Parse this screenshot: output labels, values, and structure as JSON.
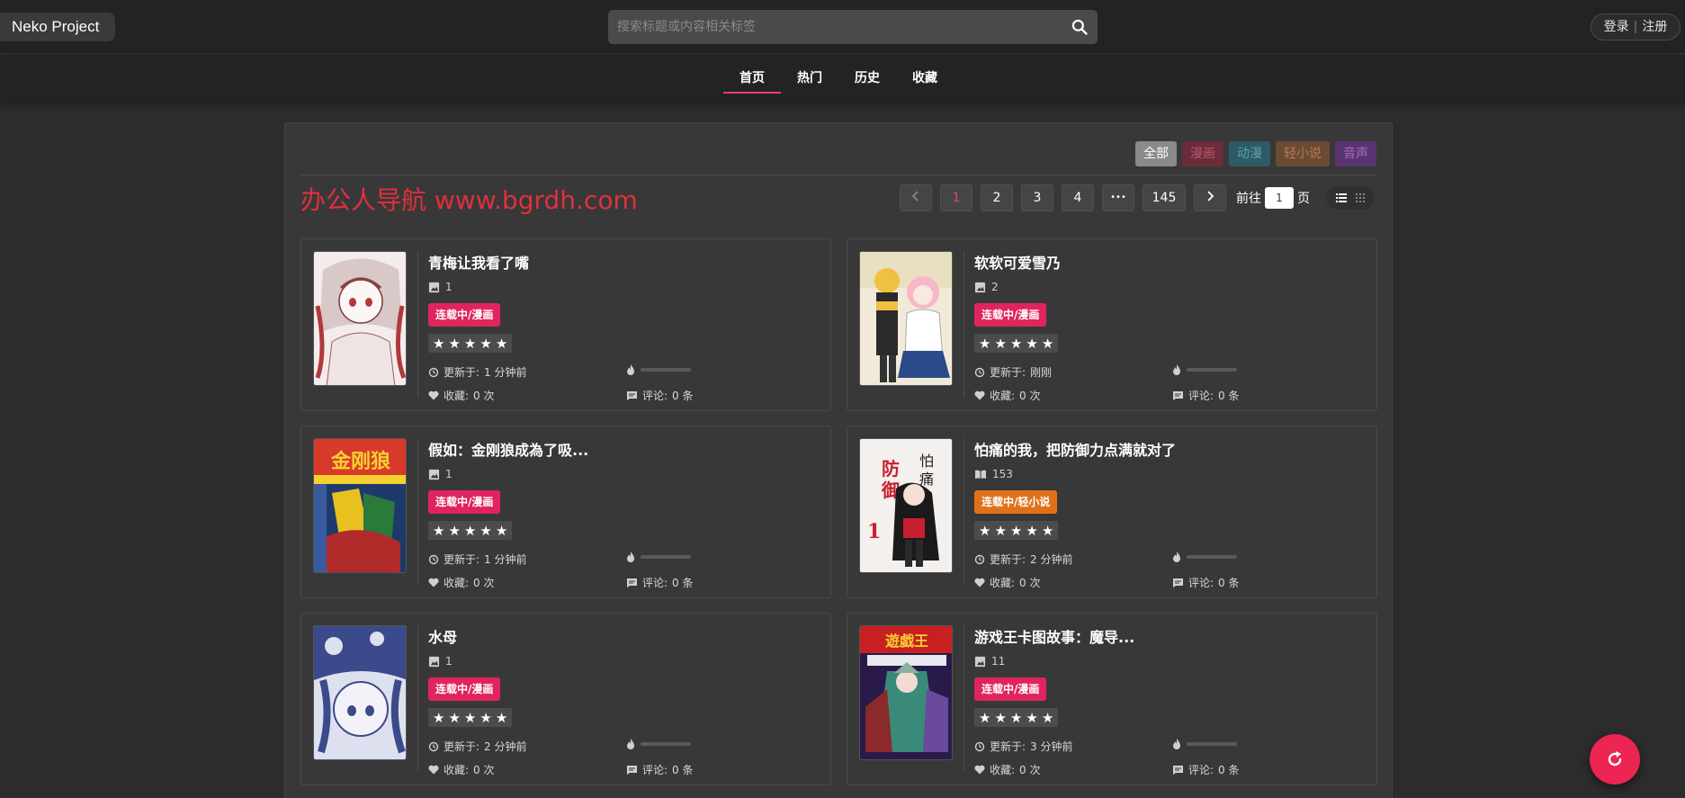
{
  "header": {
    "logo": "Neko Project",
    "search_placeholder": "搜索标题或内容相关标签",
    "login": "登录",
    "register": "注册"
  },
  "nav": [
    {
      "label": "首页",
      "active": true
    },
    {
      "label": "热门",
      "active": false
    },
    {
      "label": "历史",
      "active": false
    },
    {
      "label": "收藏",
      "active": false
    }
  ],
  "filters": [
    {
      "label": "全部",
      "bg": "#8a8a8a",
      "color": "#ffffff"
    },
    {
      "label": "漫画",
      "bg": "#6b2c3b",
      "color": "#b8566d"
    },
    {
      "label": "动漫",
      "bg": "#2d5a66",
      "color": "#5da2b3"
    },
    {
      "label": "轻小说",
      "bg": "#6b4a35",
      "color": "#b57b52"
    },
    {
      "label": "音声",
      "bg": "#5a3470",
      "color": "#a26cc3"
    }
  ],
  "watermark": "办公人导航  www.bgrdh.com",
  "pagination": {
    "prev_icon": "chevron-left-icon",
    "pages": [
      "1",
      "2",
      "3",
      "4"
    ],
    "current": "1",
    "ellipsis": "•••",
    "last": "145",
    "next_icon": "chevron-right-icon",
    "goto_label": "前往",
    "goto_value": "1",
    "goto_suffix": "页"
  },
  "labels": {
    "updated": "更新于:",
    "favorites": "收藏:",
    "comments": "评论:"
  },
  "items": [
    {
      "title": "青梅让我看了嘴",
      "count": "1",
      "count_icon": "image-icon",
      "status": "连载中/漫画",
      "status_color": "#e0245e",
      "rating": 5,
      "updated": "1 分钟前",
      "favorites": "0 次",
      "comments": "0 条",
      "heat": 0
    },
    {
      "title": "软软可爱雪乃",
      "count": "2",
      "count_icon": "image-icon",
      "status": "连载中/漫画",
      "status_color": "#e0245e",
      "rating": 5,
      "updated": "刚刚",
      "favorites": "0 次",
      "comments": "0 条",
      "heat": 0
    },
    {
      "title": "假如：金刚狼成為了吸...",
      "count": "1",
      "count_icon": "image-icon",
      "status": "连载中/漫画",
      "status_color": "#e0245e",
      "rating": 5,
      "updated": "1 分钟前",
      "favorites": "0 次",
      "comments": "0 条",
      "heat": 0
    },
    {
      "title": "怕痛的我，把防御力点满就对了",
      "count": "153",
      "count_icon": "book-icon",
      "status": "连载中/轻小说",
      "status_color": "#e0711a",
      "rating": 5,
      "updated": "2 分钟前",
      "favorites": "0 次",
      "comments": "0 条",
      "heat": 0
    },
    {
      "title": "水母",
      "count": "1",
      "count_icon": "image-icon",
      "status": "连载中/漫画",
      "status_color": "#e0245e",
      "rating": 5,
      "updated": "2 分钟前",
      "favorites": "0 次",
      "comments": "0 条",
      "heat": 0
    },
    {
      "title": "游戏王卡图故事：魔导...",
      "count": "11",
      "count_icon": "image-icon",
      "status": "连载中/漫画",
      "status_color": "#e0245e",
      "rating": 5,
      "updated": "3 分钟前",
      "favorites": "0 次",
      "comments": "0 条",
      "heat": 0
    }
  ],
  "fab_icon": "refresh-icon"
}
